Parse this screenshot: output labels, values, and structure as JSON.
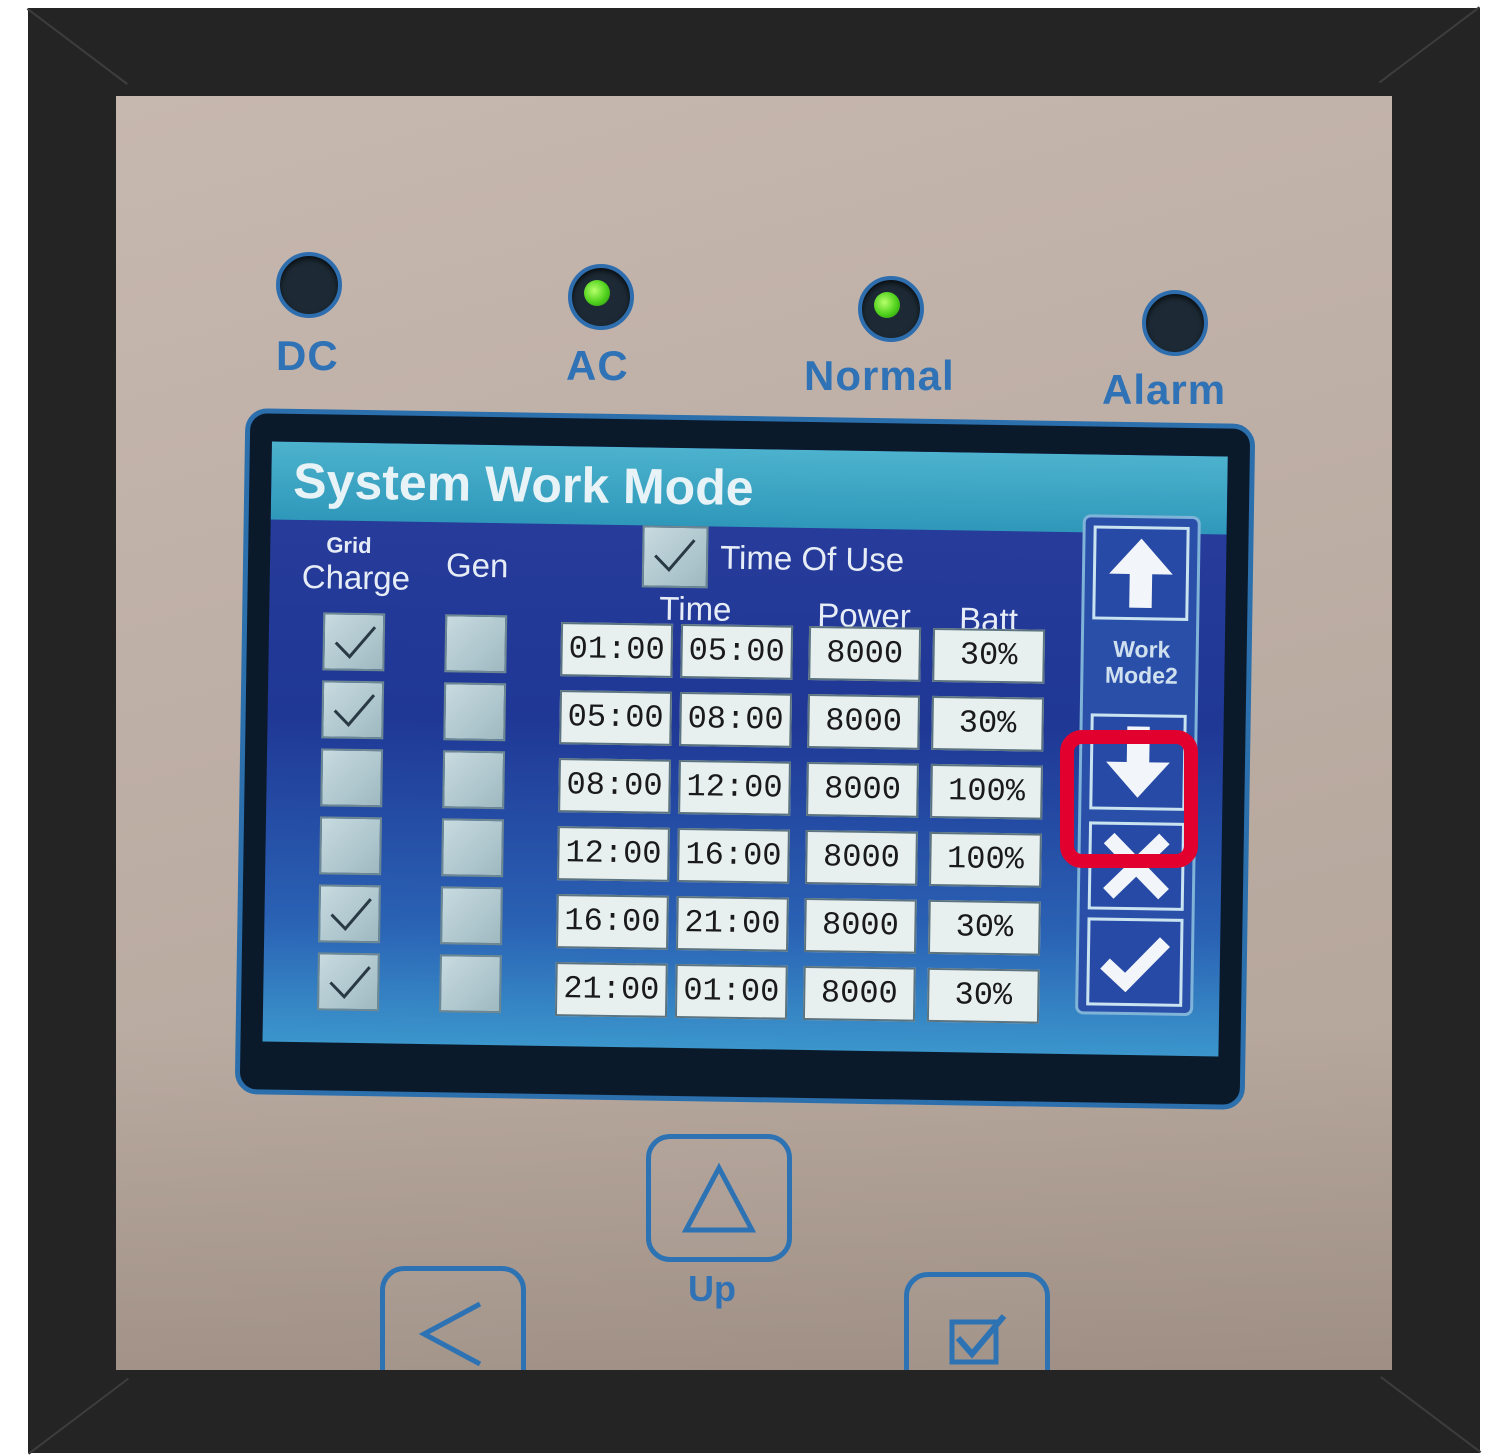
{
  "indicators": [
    {
      "label": "DC",
      "state": "off"
    },
    {
      "label": "AC",
      "state": "on"
    },
    {
      "label": "Normal",
      "state": "on"
    },
    {
      "label": "Alarm",
      "state": "off"
    }
  ],
  "screen": {
    "title": "System Work Mode",
    "headers": {
      "grid": "Grid",
      "charge": "Charge",
      "gen": "Gen",
      "time": "Time",
      "power": "Power",
      "batt": "Batt"
    },
    "time_of_use": {
      "label": "Time Of Use",
      "checked": true
    },
    "rows": [
      {
        "grid_charge": true,
        "gen": false,
        "start": "01:00",
        "end": "05:00",
        "power": "8000",
        "batt": "30%"
      },
      {
        "grid_charge": true,
        "gen": false,
        "start": "05:00",
        "end": "08:00",
        "power": "8000",
        "batt": "30%"
      },
      {
        "grid_charge": false,
        "gen": false,
        "start": "08:00",
        "end": "12:00",
        "power": "8000",
        "batt": "100%"
      },
      {
        "grid_charge": false,
        "gen": false,
        "start": "12:00",
        "end": "16:00",
        "power": "8000",
        "batt": "100%"
      },
      {
        "grid_charge": true,
        "gen": false,
        "start": "16:00",
        "end": "21:00",
        "power": "8000",
        "batt": "30%"
      },
      {
        "grid_charge": true,
        "gen": false,
        "start": "21:00",
        "end": "01:00",
        "power": "8000",
        "batt": "30%"
      }
    ],
    "side_panel": {
      "work_mode_line1": "Work",
      "work_mode_line2": "Mode2"
    }
  },
  "keypad": {
    "up_label": "Up"
  },
  "colors": {
    "highlight": "#e2002f",
    "led_green": "#4fd11c",
    "panel_blue": "#2f72b5"
  }
}
